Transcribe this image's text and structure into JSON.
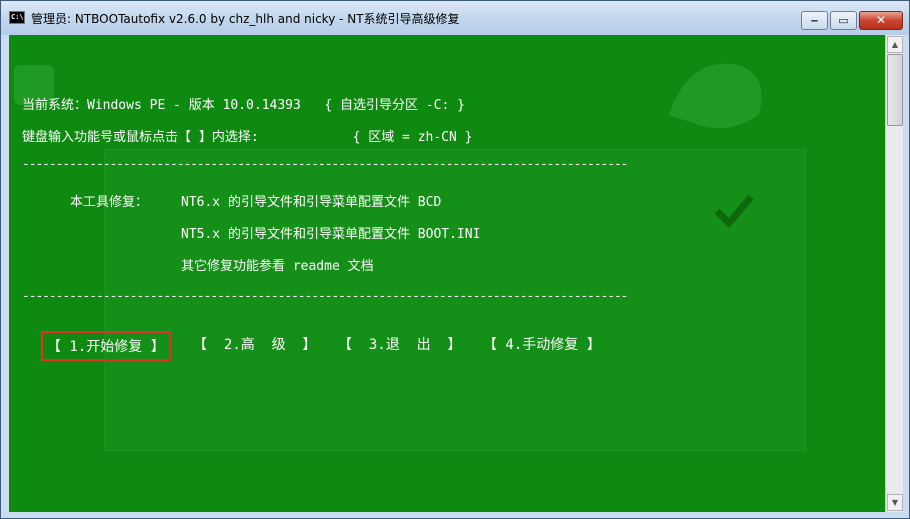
{
  "window": {
    "title": "管理员:  NTBOOTautofix v2.6.0 by chz_hlh and nicky - NT系统引导高级修复",
    "icon_text": "C:\\",
    "controls": {
      "minimize": "‒",
      "maximize": "▭",
      "close": "✕"
    }
  },
  "console": {
    "system_line": "当前系统：Windows PE - 版本 10.0.14393   { 自选引导分区 -C: }",
    "prompt_line": "键盘输入功能号或鼠标点击【 】内选择:            { 区域 = zh-CN }",
    "separator": "------------------------------------------------------------------------------------------",
    "repair_heading": "本工具修复：",
    "repair_items": [
      "NT6.x 的引导文件和引导菜单配置文件 BCD",
      "NT5.x 的引导文件和引导菜单配置文件 BOOT.INI",
      "其它修复功能参看 readme 文档"
    ]
  },
  "menu": [
    {
      "label": "【 1.开始修复 】",
      "selected": true
    },
    {
      "label": "【  2.高  级  】",
      "selected": false
    },
    {
      "label": "【  3.退  出  】",
      "selected": false
    },
    {
      "label": "【 4.手动修复 】",
      "selected": false
    }
  ],
  "colors": {
    "console_bg": "#0e8a10",
    "text": "#ffffff",
    "selection_border": "#e0322a"
  }
}
